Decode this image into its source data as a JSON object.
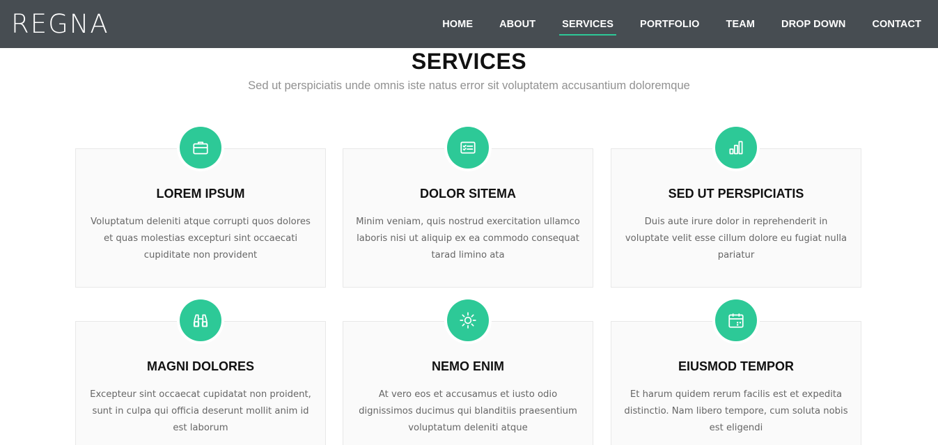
{
  "header": {
    "logo": "REGNA",
    "nav": [
      "HOME",
      "ABOUT",
      "SERVICES",
      "PORTFOLIO",
      "TEAM",
      "DROP DOWN",
      "CONTACT"
    ],
    "active": "SERVICES"
  },
  "services": {
    "title": "SERVICES",
    "subtitle": "Sed ut perspiciatis unde omnis iste natus error sit voluptatem accusantium doloremque",
    "accent_color": "#2dc997",
    "items": [
      {
        "icon": "briefcase-icon",
        "title": "LOREM IPSUM",
        "text": "Voluptatum deleniti atque corrupti quos dolores et quas molestias excepturi sint occaecati cupiditate non provident"
      },
      {
        "icon": "card-checklist-icon",
        "title": "DOLOR SITEMA",
        "text": "Minim veniam, quis nostrud exercitation ullamco laboris nisi ut aliquip ex ea commodo consequat tarad limino ata"
      },
      {
        "icon": "bar-chart-icon",
        "title": "SED UT PERSPICIATIS",
        "text": "Duis aute irure dolor in reprehenderit in voluptate velit esse cillum dolore eu fugiat nulla pariatur"
      },
      {
        "icon": "binoculars-icon",
        "title": "MAGNI DOLORES",
        "text": "Excepteur sint occaecat cupidatat non proident, sunt in culpa qui officia deserunt mollit anim id est laborum"
      },
      {
        "icon": "sun-icon",
        "title": "NEMO ENIM",
        "text": "At vero eos et accusamus et iusto odio dignissimos ducimus qui blanditiis praesentium voluptatum deleniti atque"
      },
      {
        "icon": "calendar-icon",
        "title": "EIUSMOD TEMPOR",
        "text": "Et harum quidem rerum facilis est et expedita distinctio. Nam libero tempore, cum soluta nobis est eligendi"
      }
    ]
  }
}
